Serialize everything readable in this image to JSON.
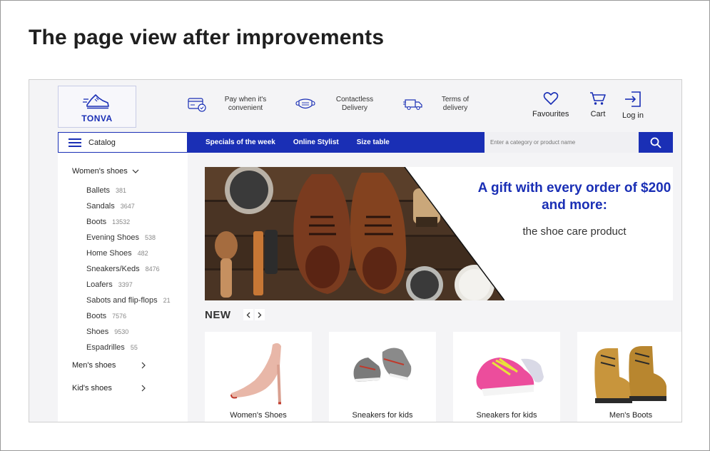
{
  "page": {
    "heading": "The page view after improvements"
  },
  "logo": {
    "text": "TONVA"
  },
  "features": [
    {
      "text": "Pay when it's convenient"
    },
    {
      "text": "Contactless Delivery"
    },
    {
      "text": "Terms of delivery"
    }
  ],
  "header_actions": {
    "favourites": "Favourites",
    "cart": "Cart",
    "login": "Log in"
  },
  "nav": {
    "catalog": "Catalog",
    "links": [
      "Specials of the week",
      "Online Stylist",
      "Size table"
    ],
    "search_placeholder": "Enter a category or product name"
  },
  "sidebar": {
    "womens": {
      "label": "Women's shoes",
      "items": [
        {
          "label": "Ballets",
          "count": "381"
        },
        {
          "label": "Sandals",
          "count": "3647"
        },
        {
          "label": "Boots",
          "count": "13532"
        },
        {
          "label": "Evening Shoes",
          "count": "538"
        },
        {
          "label": "Home Shoes",
          "count": "482"
        },
        {
          "label": "Sneakers/Keds",
          "count": "8476"
        },
        {
          "label": "Loafers",
          "count": "3397"
        },
        {
          "label": "Sabots and flip-flops",
          "count": "21"
        },
        {
          "label": "Boots",
          "count": "7576"
        },
        {
          "label": "Shoes",
          "count": "9530"
        },
        {
          "label": "Espadrilles",
          "count": "55"
        }
      ]
    },
    "mens": {
      "label": "Men's shoes"
    },
    "kids": {
      "label": "Kid's shoes"
    }
  },
  "banner": {
    "title": "A gift with every order of $200 and more:",
    "subtitle": "the shoe care product"
  },
  "new_section": {
    "title": "New",
    "products": [
      {
        "label": "Women's Shoes"
      },
      {
        "label": "Sneakers for kids"
      },
      {
        "label": "Sneakers for kids"
      },
      {
        "label": "Men's Boots"
      }
    ]
  },
  "colors": {
    "brand_blue": "#1a2fb5",
    "background": "#f4f4f6"
  }
}
